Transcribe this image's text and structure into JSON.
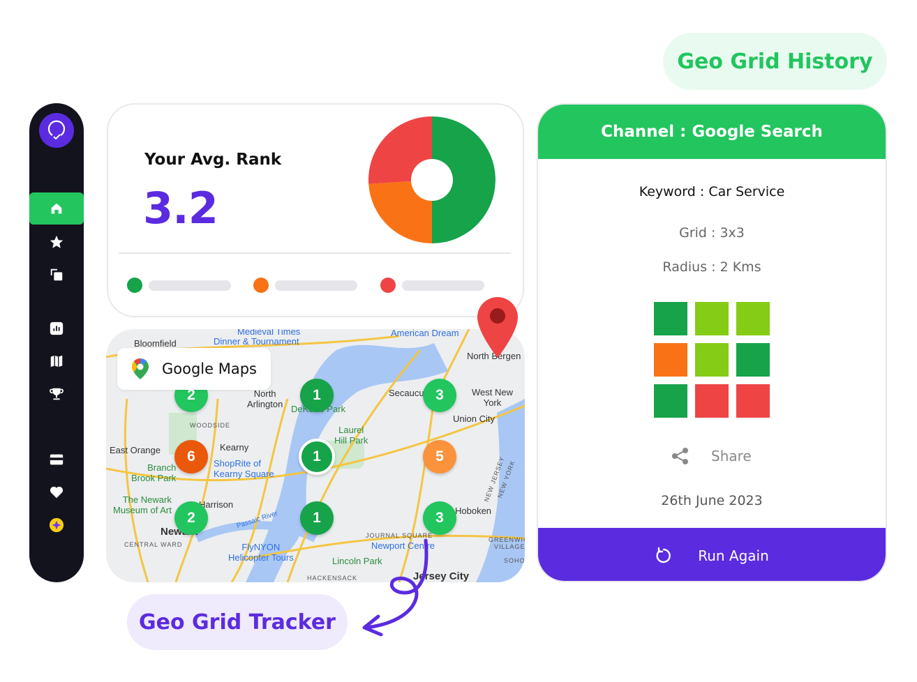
{
  "sidebar": {
    "items": [
      {
        "icon": "home-icon",
        "active": true
      },
      {
        "icon": "star-icon"
      },
      {
        "icon": "copy-icon"
      },
      {
        "icon": "bar-chart-icon"
      },
      {
        "icon": "map-icon"
      },
      {
        "icon": "trophy-icon"
      },
      {
        "icon": "credit-card-icon"
      },
      {
        "icon": "heart-icon"
      },
      {
        "icon": "sparkle-icon"
      }
    ]
  },
  "rank_card": {
    "title": "Your Avg. Rank",
    "value": "3.2",
    "chart_data": {
      "type": "pie",
      "donut": true,
      "values": [
        50,
        24,
        26
      ],
      "colors": [
        "#16a34a",
        "#f97316",
        "#ef4444"
      ]
    },
    "legend_colors": [
      "#16a34a",
      "#f97316",
      "#ef4444"
    ]
  },
  "map": {
    "badge": "Google Maps",
    "labels": [
      "Medieval Times",
      "Dinner & Tournament",
      "American Dream",
      "Bloomfield",
      "North Bergen",
      "North",
      "Arlington",
      "Secaucus",
      "West New",
      "York",
      "Union City",
      "WOODSIDE",
      "East Orange",
      "Kearny",
      "Laurel",
      "Hill Park",
      "ShopRite of",
      "Kearny Square",
      "Branch",
      "Brook Park",
      "The Newark",
      "Museum of Art",
      "Harrison",
      "Newark",
      "CENTRAL WARD",
      "Passaic River",
      "FlyNYON",
      "Helicopter Tours",
      "JOURNAL SQUARE",
      "Newport Centre",
      "Lincoln Park",
      "Jersey City",
      "Hoboken",
      "NEW JERSEY",
      "NEW YORK",
      "GREENWICH",
      "VILLAGE",
      "SOHO",
      "HACKENSACK",
      "DeKorte Park"
    ],
    "pins": [
      {
        "rank": "2",
        "color": "#22c55e"
      },
      {
        "rank": "1",
        "color": "#16a34a"
      },
      {
        "rank": "3",
        "color": "#22c55e"
      },
      {
        "rank": "6",
        "color": "#ea580c"
      },
      {
        "rank": "1",
        "color": "#16a34a"
      },
      {
        "rank": "5",
        "color": "#fb923c"
      },
      {
        "rank": "2",
        "color": "#22c55e"
      },
      {
        "rank": "1",
        "color": "#16a34a"
      },
      {
        "rank": "3",
        "color": "#22c55e"
      }
    ]
  },
  "history_badge": "Geo Grid History",
  "tracker_badge": "Geo Grid Tracker",
  "channel_card": {
    "header": "Channel : Google Search",
    "keyword": "Keyword : Car Service",
    "grid": "Grid : 3x3",
    "radius": "Radius : 2 Kms",
    "grid_colors": [
      "#16a34a",
      "#84cc16",
      "#84cc16",
      "#f97316",
      "#84cc16",
      "#16a34a",
      "#16a34a",
      "#ef4444",
      "#ef4444"
    ],
    "share_label": "Share",
    "date": "26th June 2023",
    "run_label": "Run Again"
  }
}
